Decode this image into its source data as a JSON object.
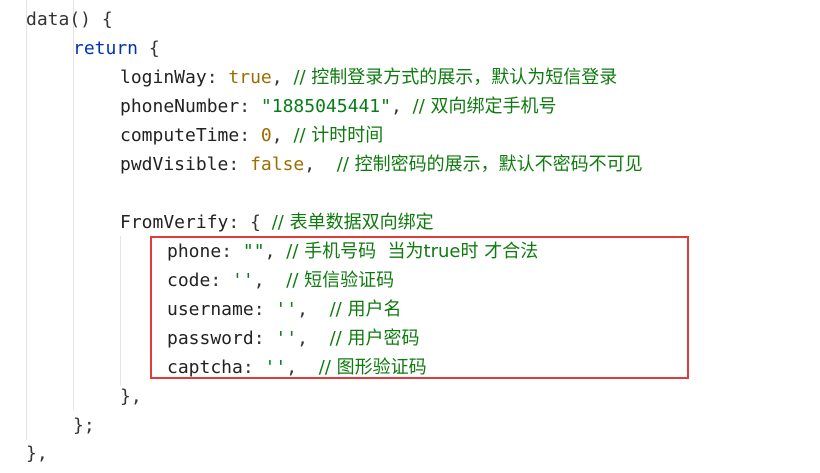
{
  "editor": {
    "lines": [
      {
        "segments": [
          {
            "t": "data() {",
            "c": "punc"
          }
        ]
      },
      {
        "segments": [
          {
            "t": "return",
            "c": "kw"
          },
          {
            "t": " {",
            "c": "punc"
          }
        ]
      },
      {
        "segments": [
          {
            "t": "loginWay",
            "c": "prop"
          },
          {
            "t": ": ",
            "c": "punc"
          },
          {
            "t": "true",
            "c": "bool"
          },
          {
            "t": ", ",
            "c": "punc"
          },
          {
            "t": "// 控制登录方式的展示，默认为短信登录",
            "c": "cmt"
          }
        ]
      },
      {
        "segments": [
          {
            "t": "phoneNumber",
            "c": "prop"
          },
          {
            "t": ": ",
            "c": "punc"
          },
          {
            "t": "\"1885045441\"",
            "c": "str"
          },
          {
            "t": ", ",
            "c": "punc"
          },
          {
            "t": "// 双向绑定手机号",
            "c": "cmt"
          }
        ]
      },
      {
        "segments": [
          {
            "t": "computeTime",
            "c": "prop"
          },
          {
            "t": ": ",
            "c": "punc"
          },
          {
            "t": "0",
            "c": "num"
          },
          {
            "t": ", ",
            "c": "punc"
          },
          {
            "t": "// 计时时间",
            "c": "cmt"
          }
        ]
      },
      {
        "segments": [
          {
            "t": "pwdVisible",
            "c": "prop"
          },
          {
            "t": ": ",
            "c": "punc"
          },
          {
            "t": "false",
            "c": "bool"
          },
          {
            "t": ",  ",
            "c": "punc"
          },
          {
            "t": "// 控制密码的展示，默认不密码不可见",
            "c": "cmt"
          }
        ]
      },
      {
        "segments": []
      },
      {
        "segments": [
          {
            "t": "FromVerify",
            "c": "prop"
          },
          {
            "t": ": { ",
            "c": "punc"
          },
          {
            "t": "// 表单数据双向绑定",
            "c": "cmt"
          }
        ]
      },
      {
        "segments": [
          {
            "t": "phone",
            "c": "prop"
          },
          {
            "t": ": ",
            "c": "punc"
          },
          {
            "t": "\"\"",
            "c": "str"
          },
          {
            "t": ", ",
            "c": "punc"
          },
          {
            "t": "// 手机号码  当为true时 才合法",
            "c": "cmt"
          }
        ]
      },
      {
        "segments": [
          {
            "t": "code",
            "c": "prop"
          },
          {
            "t": ": ",
            "c": "punc"
          },
          {
            "t": "''",
            "c": "str"
          },
          {
            "t": ",  ",
            "c": "punc"
          },
          {
            "t": "// 短信验证码",
            "c": "cmt"
          }
        ]
      },
      {
        "segments": [
          {
            "t": "username",
            "c": "prop"
          },
          {
            "t": ": ",
            "c": "punc"
          },
          {
            "t": "''",
            "c": "str"
          },
          {
            "t": ",  ",
            "c": "punc"
          },
          {
            "t": "// 用户名",
            "c": "cmt"
          }
        ]
      },
      {
        "segments": [
          {
            "t": "password",
            "c": "prop"
          },
          {
            "t": ": ",
            "c": "punc"
          },
          {
            "t": "''",
            "c": "str"
          },
          {
            "t": ",  ",
            "c": "punc"
          },
          {
            "t": "// 用户密码",
            "c": "cmt"
          }
        ]
      },
      {
        "segments": [
          {
            "t": "captcha",
            "c": "prop"
          },
          {
            "t": ": ",
            "c": "punc"
          },
          {
            "t": "''",
            "c": "str"
          },
          {
            "t": ",  ",
            "c": "punc"
          },
          {
            "t": "// 图形验证码",
            "c": "cmt"
          }
        ]
      },
      {
        "segments": [
          {
            "t": "},",
            "c": "punc"
          }
        ]
      },
      {
        "segments": [
          {
            "t": "};",
            "c": "punc"
          }
        ]
      },
      {
        "segments": [
          {
            "t": "},",
            "c": "punc"
          }
        ]
      }
    ]
  },
  "colors": {
    "keyword": "#0033b3",
    "string": "#067d17",
    "comment": "#0f7b0f",
    "literal": "#9a6e00",
    "highlight_border": "#e03c3c"
  }
}
